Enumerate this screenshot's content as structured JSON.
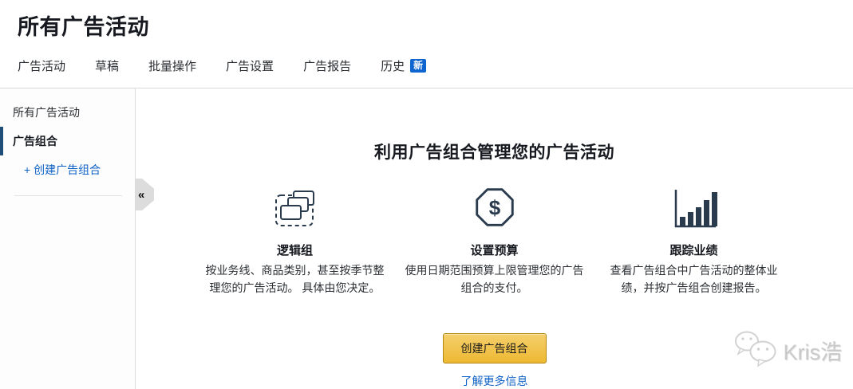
{
  "header": {
    "title": "所有广告活动"
  },
  "tabs": [
    {
      "label": "广告活动"
    },
    {
      "label": "草稿"
    },
    {
      "label": "批量操作"
    },
    {
      "label": "广告设置"
    },
    {
      "label": "广告报告"
    },
    {
      "label": "历史",
      "badge": "新"
    }
  ],
  "sidebar": {
    "items": [
      {
        "label": "所有广告活动"
      },
      {
        "label": "广告组合",
        "active": true
      },
      {
        "label": "+ 创建广告组合"
      }
    ],
    "collapse_glyph": "«"
  },
  "main": {
    "heading": "利用广告组合管理您的广告活动",
    "features": [
      {
        "icon": "logical-group-icon",
        "title": "逻辑组",
        "desc": "按业务线、商品类别，甚至按季节整理您的广告活动。 具体由您决定。"
      },
      {
        "icon": "budget-dollar-octagon-icon",
        "title": "设置预算",
        "desc": "使用日期范围预算上限管理您的广告组合的支付。"
      },
      {
        "icon": "bar-chart-icon",
        "title": "跟踪业绩",
        "desc": "查看广告组合中广告活动的整体业绩，并按广告组合创建报告。"
      }
    ],
    "cta_label": "创建广告组合",
    "learn_more_label": "了解更多信息"
  },
  "watermark": {
    "text": "Kris浩"
  },
  "colors": {
    "accent_gold": "#f0c14b",
    "link_blue": "#0f62c6",
    "badge_blue": "#0e65d0",
    "active_bar_blue": "#1f4e79",
    "icon_navy": "#2b3b4e"
  }
}
